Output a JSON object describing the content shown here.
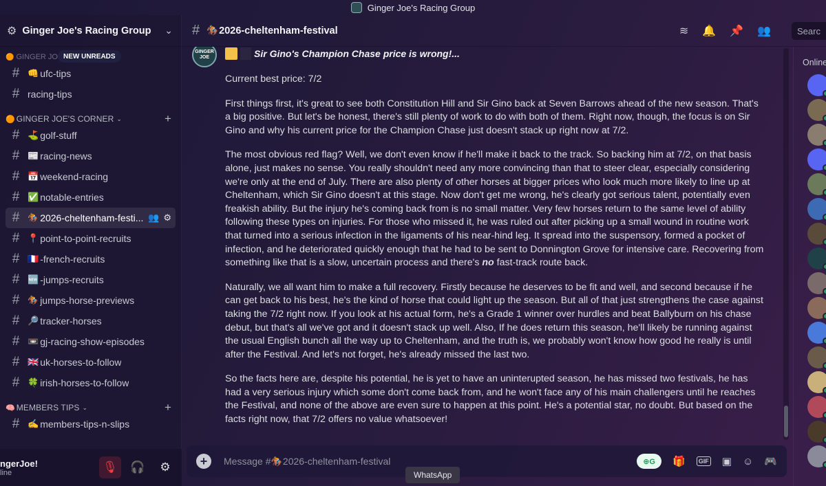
{
  "window": {
    "title": "Ginger Joe's Racing Group"
  },
  "server": {
    "name": "Ginger Joe's Racing Group"
  },
  "sidebar": {
    "faded_category": "GINGER JOE...",
    "new_unreads": "NEW UNREADS",
    "top_channels": [
      {
        "emoji": "👊",
        "label": "ufc-tips"
      },
      {
        "emoji": "",
        "label": "racing-tips"
      }
    ],
    "corner_category": {
      "emoji": "🟠",
      "label": "GINGER JOE'S CORNER"
    },
    "corner_channels": [
      {
        "emoji": "⛳",
        "label": "golf-stuff"
      },
      {
        "emoji": "📰",
        "label": "racing-news"
      },
      {
        "emoji": "📅",
        "label": "weekend-racing"
      },
      {
        "emoji": "✅",
        "label": "notable-entries"
      },
      {
        "emoji": "🏇",
        "label": "2026-cheltenham-festi..."
      },
      {
        "emoji": "📍",
        "label": "point-to-point-recruits"
      },
      {
        "emoji": "🇫🇷",
        "label": "-french-recruits"
      },
      {
        "emoji": "🆕",
        "label": "-jumps-recruits"
      },
      {
        "emoji": "🏇",
        "label": "jumps-horse-previews"
      },
      {
        "emoji": "🔎",
        "label": "tracker-horses"
      },
      {
        "emoji": "📼",
        "label": "gj-racing-show-episodes"
      },
      {
        "emoji": "🇬🇧",
        "label": "uk-horses-to-follow"
      },
      {
        "emoji": "🍀",
        "label": "irish-horses-to-follow"
      }
    ],
    "members_category": {
      "emoji": "🧠",
      "label": "MEMBERS TIPS"
    },
    "members_channels": [
      {
        "emoji": "✍️",
        "label": "members-tips-n-slips"
      }
    ]
  },
  "user": {
    "name": "ngerJoe!",
    "status": "line"
  },
  "channel": {
    "title": "🏇2026-cheltenham-festival"
  },
  "header": {
    "search_placeholder": "Searc"
  },
  "message": {
    "avatar_text": "GINGER JOE",
    "title": "Sir Gino's Champion Chase price is wrong!...",
    "paragraphs": [
      "Current best price: 7/2",
      "First things first, it's great to see both Constitution Hill and Sir Gino back at Seven Barrows ahead of the new season. That's a big positive. But let's be honest, there's still plenty of work to do with both of them. Right now, though, the focus is on Sir Gino and why his current price for the Champion Chase just doesn't stack up right now at 7/2.",
      "The most obvious red flag? Well, we don't even know if he'll make it back to the track. So backing him at 7/2, on that basis alone, just makes no sense. You really shouldn't need any more convincing than that to steer clear, especially considering we're only at the end of July. There are also plenty of other horses at bigger prices who look much more likely to line up at Cheltenham, which Sir Gino doesn't at this stage. Now don't get me wrong, he's clearly got serious talent, potentially even freakish ability. But the injury he's coming back from is no small matter. Very few horses return to the same level of ability following these types on injuries. For those who missed it, he was ruled out after picking up a small wound in routine work that turned into a serious infection in the ligaments of his near-hind leg. It spread into the suspensory, formed a pocket of infection, and he deteriorated quickly enough that he had to be sent to Donnington Grove for intensive care. Recovering from something like that is a slow, uncertain process and there's",
      "Naturally, we all want him to make a full recovery. Firstly because he deserves to be fit and well, and second because if he can get back to his best, he's the kind of horse that could light up the season. But all of that just strengthens the case against taking the 7/2 right now. If you look at his actual form, he's a Grade 1 winner over hurdles and beat Ballyburn on his chase debut, but that's all we've got and it doesn't stack up well. Also, If he does return this season, he'll likely be running against the usual English bunch all the way up to Cheltenham, and the truth is, we probably won't know how good he really is until after the Festival. And let's not forget, he's already missed the last two.",
      "So the facts here are, despite his potential, he is yet to have an uninterupted season, he has missed two festivals, he has had a very serious injury which some don't come back from, and he won't face any of his main challengers until he reaches the Festival, and none of the above are even sure to happen at this point. He's a potential star, no doubt. But based on the facts right now, that 7/2 offers no value whatsoever!"
    ],
    "emphasis_no": "no",
    "emphasis_tail": " fast-track route back."
  },
  "composer": {
    "placeholder": "Message #🏇2026-cheltenham-festival",
    "gif": "GIF"
  },
  "tooltip": "WhatsApp",
  "members": {
    "header": "Online",
    "avatar_colors": [
      "#5865f2",
      "#7a6a52",
      "#8a7d70",
      "#5865f2",
      "#6b7a5a",
      "#3d6bb3",
      "#5a4a3a",
      "#214149",
      "#7a6a6a",
      "#8a6a5a",
      "#4a7ad9",
      "#6a5a4a",
      "#c9b07a",
      "#b04a5a",
      "#4a3a2a",
      "#8a8a9a"
    ]
  }
}
